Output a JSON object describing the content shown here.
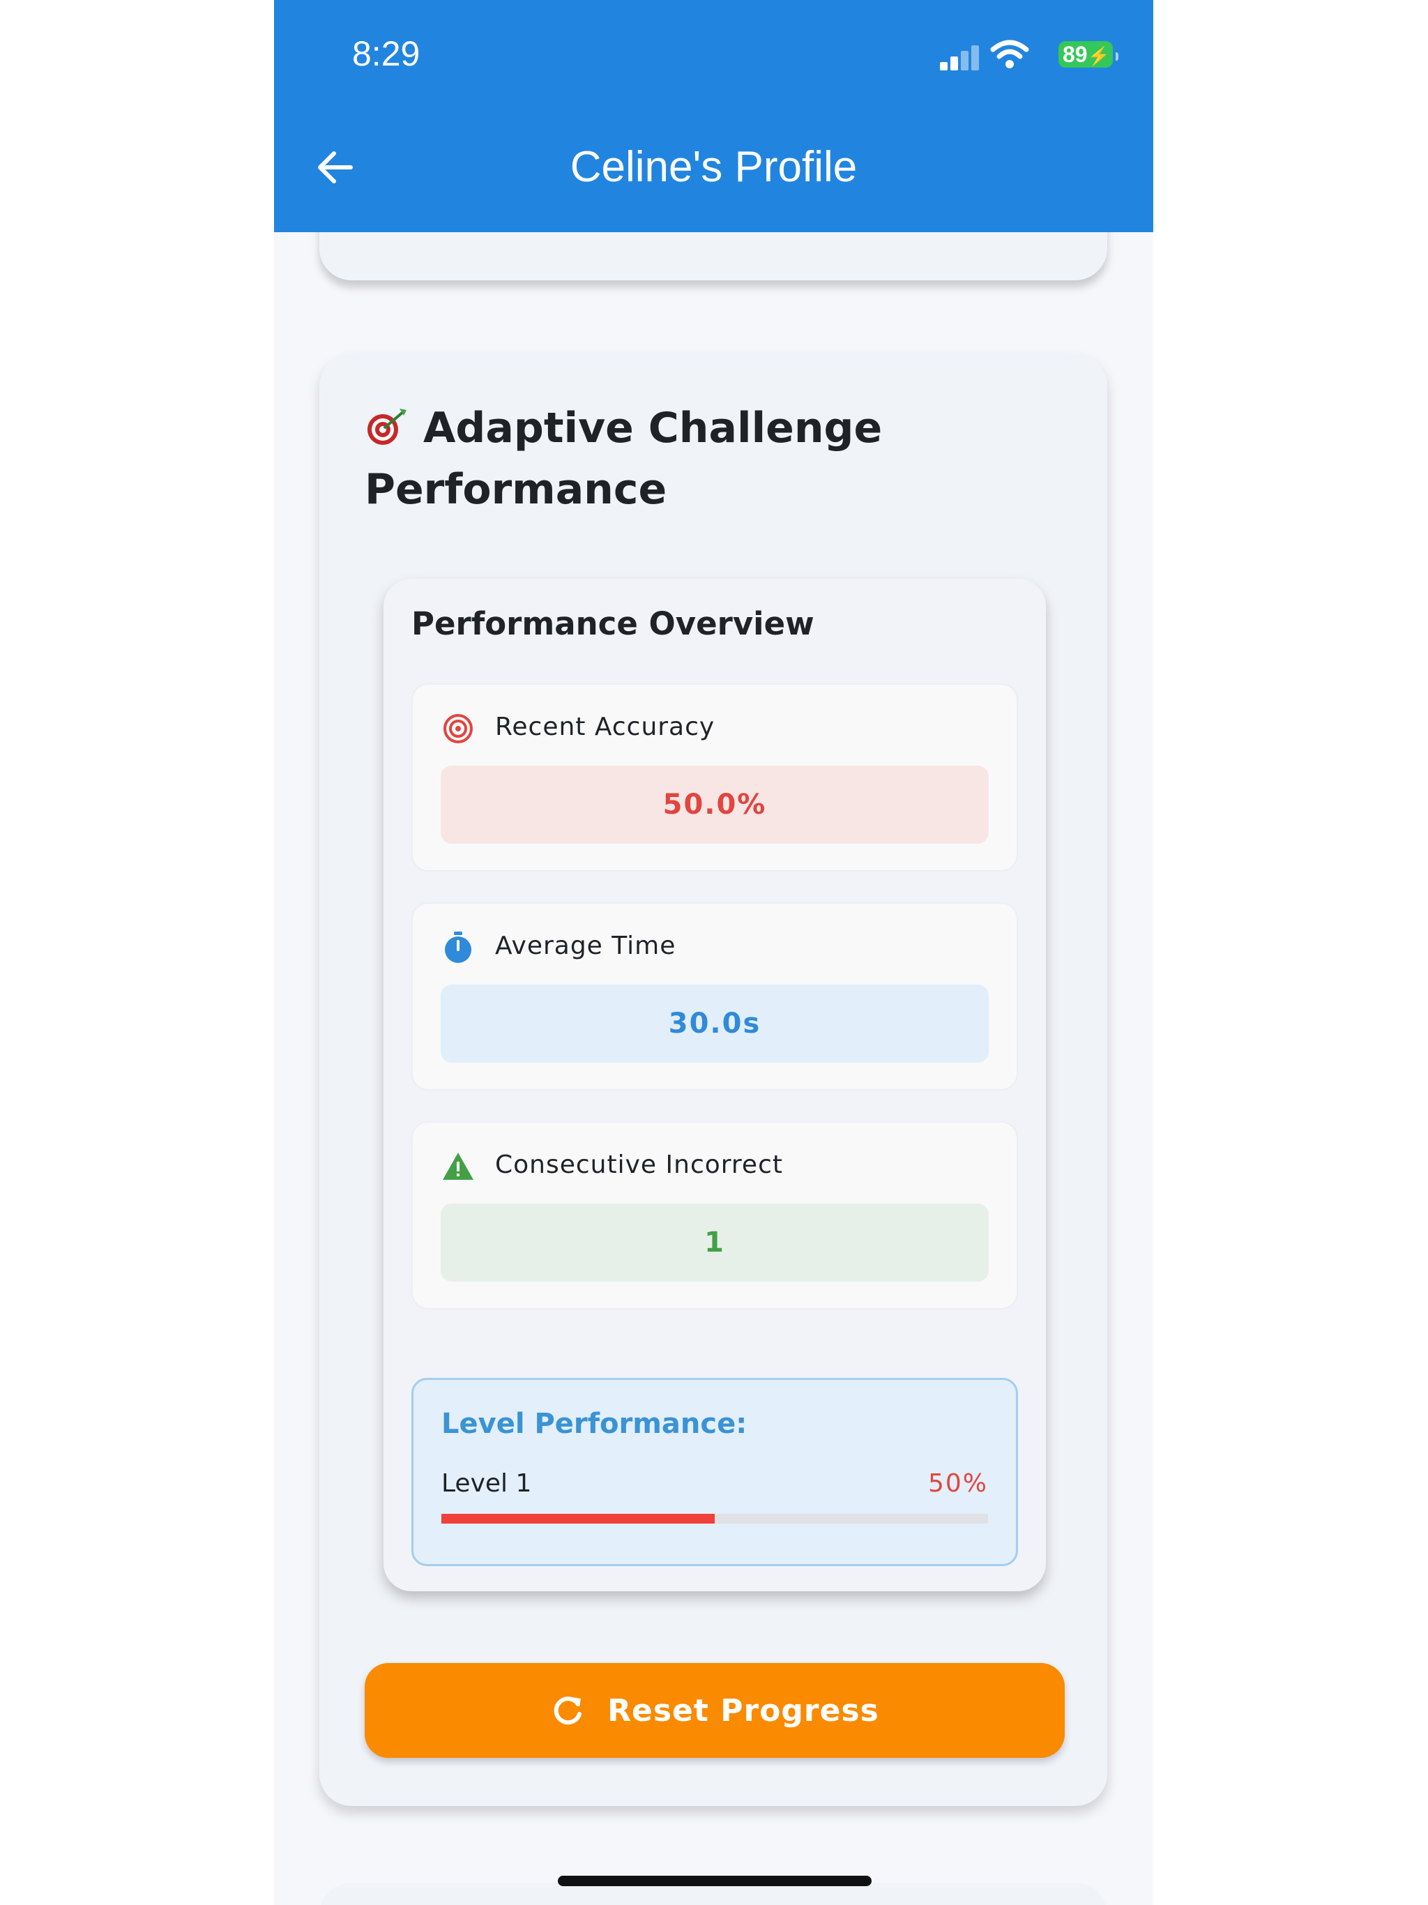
{
  "status_bar": {
    "time": "8:29",
    "battery": "89"
  },
  "app_bar": {
    "title": "Celine's Profile"
  },
  "card": {
    "heading_line1": "Adaptive Challenge",
    "heading_line2": "Performance"
  },
  "overview": {
    "title": "Performance Overview",
    "metrics": [
      {
        "label": "Recent Accuracy",
        "value": "50.0%",
        "icon": "target-icon",
        "color": "#e2453f",
        "bg": "#f8e6e5"
      },
      {
        "label": "Average Time",
        "value": "30.0s",
        "icon": "timer-icon",
        "color": "#2f8ad9",
        "bg": "#e2eef9"
      },
      {
        "label": "Consecutive Incorrect",
        "value": "1",
        "icon": "warning-icon",
        "color": "#43a047",
        "bg": "#e7f0e8"
      }
    ]
  },
  "level_performance": {
    "title": "Level Performance:",
    "level": "Level 1",
    "percent_label": "50%",
    "percent": 0.5
  },
  "reset_button": {
    "label": "Reset Progress"
  },
  "colors": {
    "app_bar": "#2185df",
    "reset_button": "#fa8a00",
    "accent_red": "#ef403a"
  }
}
